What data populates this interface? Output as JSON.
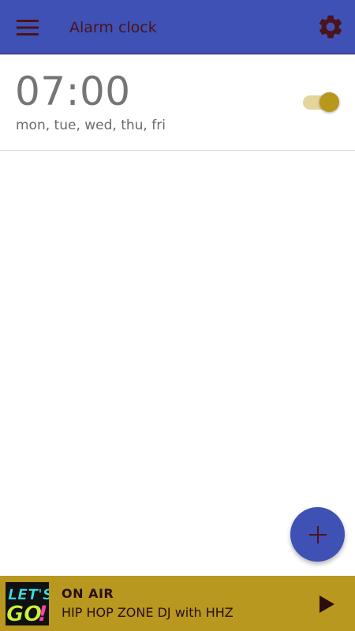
{
  "appbar": {
    "title": "Alarm clock",
    "menu_icon": "hamburger-menu-icon",
    "settings_icon": "gear-icon",
    "background_color": "#3f51b5",
    "icon_color": "#4a1418"
  },
  "alarms": [
    {
      "time": "07:00",
      "days": "mon, tue, wed, thu, fri",
      "enabled": true
    }
  ],
  "fab": {
    "icon": "plus-icon",
    "color": "#3f51b5"
  },
  "radio": {
    "logo_text": "LET'S GO!",
    "status": "ON AIR",
    "title": "HIP HOP ZONE DJ with HHZ",
    "play_icon": "play-icon",
    "background_color": "#b8981f"
  },
  "colors": {
    "toggle_thumb": "#b8981a",
    "toggle_track": "#e3d59b"
  }
}
